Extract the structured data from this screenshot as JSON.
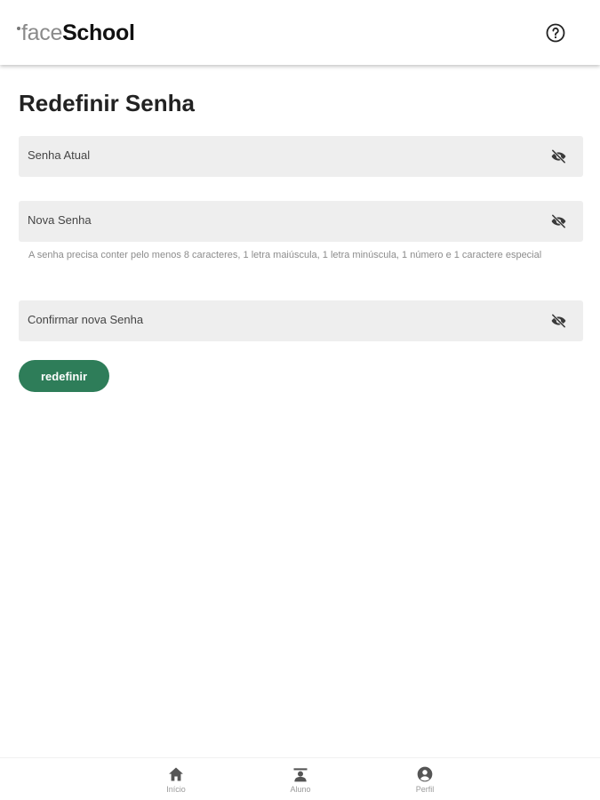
{
  "header": {
    "logo_light": "face",
    "logo_bold": "School",
    "help_icon": "help-circle-icon"
  },
  "page": {
    "title": "Redefinir Senha"
  },
  "fields": [
    {
      "label": "Senha Atual",
      "icon": "eye-off-icon"
    },
    {
      "label": "Nova Senha",
      "icon": "eye-off-icon"
    },
    {
      "label": "Confirmar nova Senha",
      "icon": "eye-off-icon"
    }
  ],
  "password_hint": "A senha precisa conter pelo menos 8 caracteres, 1 letra maiúscula, 1 letra minúscula, 1 número e 1 caractere especial",
  "submit_label": "redefinir",
  "bottom_nav": [
    {
      "label": "Início",
      "icon": "home-icon"
    },
    {
      "label": "Aluno",
      "icon": "student-icon"
    },
    {
      "label": "Perfil",
      "icon": "profile-icon"
    }
  ],
  "colors": {
    "accent": "#2e7d59",
    "field_bg": "#eeeeee",
    "nav_icon": "#555555"
  }
}
